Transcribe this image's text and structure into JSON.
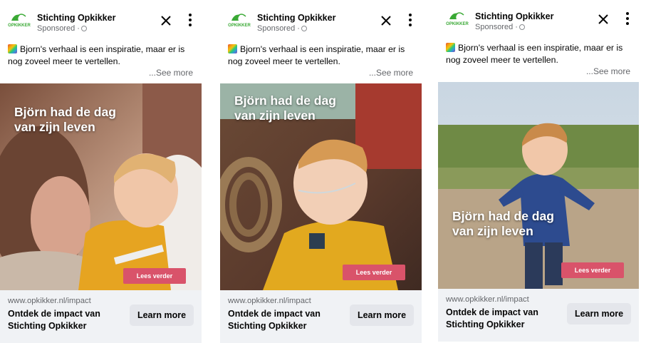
{
  "ads": [
    {
      "page_name": "Stichting Opkikker",
      "sponsored": "Sponsored ·",
      "body_text": "Bjorn's verhaal is een inspiratie, maar er is nog zoveel meer te vertellen.",
      "see_more": "...See more",
      "headline_line1": "Björn had de dag",
      "headline_line2": "van zijn leven",
      "image_cta": "Lees verder",
      "url": "www.opkikker.nl/impact",
      "title_line1": "Ontdek de impact van",
      "title_line2": "Stichting Opkikker",
      "cta": "Learn more"
    },
    {
      "page_name": "Stichting Opkikker",
      "sponsored": "Sponsored ·",
      "body_text": "Bjorn's verhaal is een inspiratie, maar er is nog zoveel meer te vertellen.",
      "see_more": "...See more",
      "headline_line1": "Björn had de dag",
      "headline_line2": "van zijn leven",
      "image_cta": "Lees verder",
      "url": "www.opkikker.nl/impact",
      "title_line1": "Ontdek de impact van",
      "title_line2": "Stichting Opkikker",
      "cta": "Learn more"
    },
    {
      "page_name": "Stichting Opkikker",
      "sponsored": "Sponsored ·",
      "body_text": "Bjorn's verhaal is een inspiratie, maar er is nog zoveel meer te vertellen.",
      "see_more": "...See more",
      "headline_line1": "Björn had de dag",
      "headline_line2": "van zijn leven",
      "image_cta": "Lees verder",
      "url": "www.opkikker.nl/impact",
      "title_line1": "Ontdek de impact van",
      "title_line2": "Stichting Opkikker",
      "cta": "Learn more"
    }
  ],
  "icons": {
    "close": "close-icon",
    "more": "more-options-icon",
    "globe": "globe-icon",
    "logo": "opkikker-logo",
    "emoji": "rainbow-emoji"
  },
  "colors": {
    "image_cta": "#d9536a",
    "footer_bg": "#f0f2f5",
    "button_bg": "#e4e6eb",
    "secondary_text": "#65676b"
  }
}
